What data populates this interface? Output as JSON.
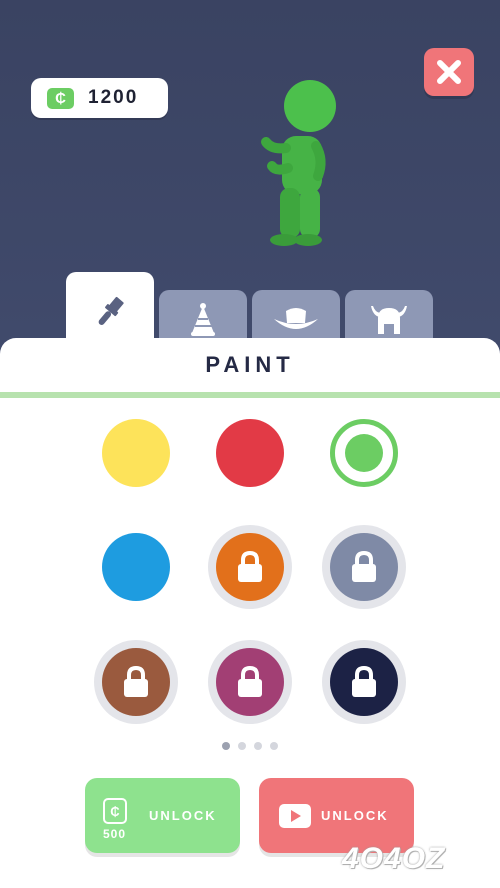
{
  "currency": {
    "amount": "1200",
    "symbol": "₵"
  },
  "tabs": [
    {
      "icon": "paintbrush-icon",
      "active": true
    },
    {
      "icon": "party-hat-icon",
      "active": false
    },
    {
      "icon": "cowboy-hat-icon",
      "active": false
    },
    {
      "icon": "viking-helmet-icon",
      "active": false
    }
  ],
  "panel": {
    "title": "PAINT"
  },
  "colors": [
    {
      "hex": "#fde35a",
      "locked": false,
      "selected": false
    },
    {
      "hex": "#e23a46",
      "locked": false,
      "selected": false
    },
    {
      "hex": "#6ccd63",
      "locked": false,
      "selected": true
    },
    {
      "hex": "#1e9ce0",
      "locked": false,
      "selected": false
    },
    {
      "hex": "#e2701b",
      "locked": true,
      "selected": false
    },
    {
      "hex": "#7f8aa6",
      "locked": true,
      "selected": false
    },
    {
      "hex": "#9a5a3e",
      "locked": true,
      "selected": false
    },
    {
      "hex": "#a23f74",
      "locked": true,
      "selected": false
    },
    {
      "hex": "#1c2245",
      "locked": true,
      "selected": false
    }
  ],
  "pagination": {
    "total": 4,
    "current": 1
  },
  "buttons": {
    "unlock_coins": {
      "label": "UNLOCK",
      "price": "500",
      "symbol": "₵"
    },
    "unlock_ad": {
      "label": "UNLOCK"
    }
  },
  "watermark": "4O4OZ"
}
